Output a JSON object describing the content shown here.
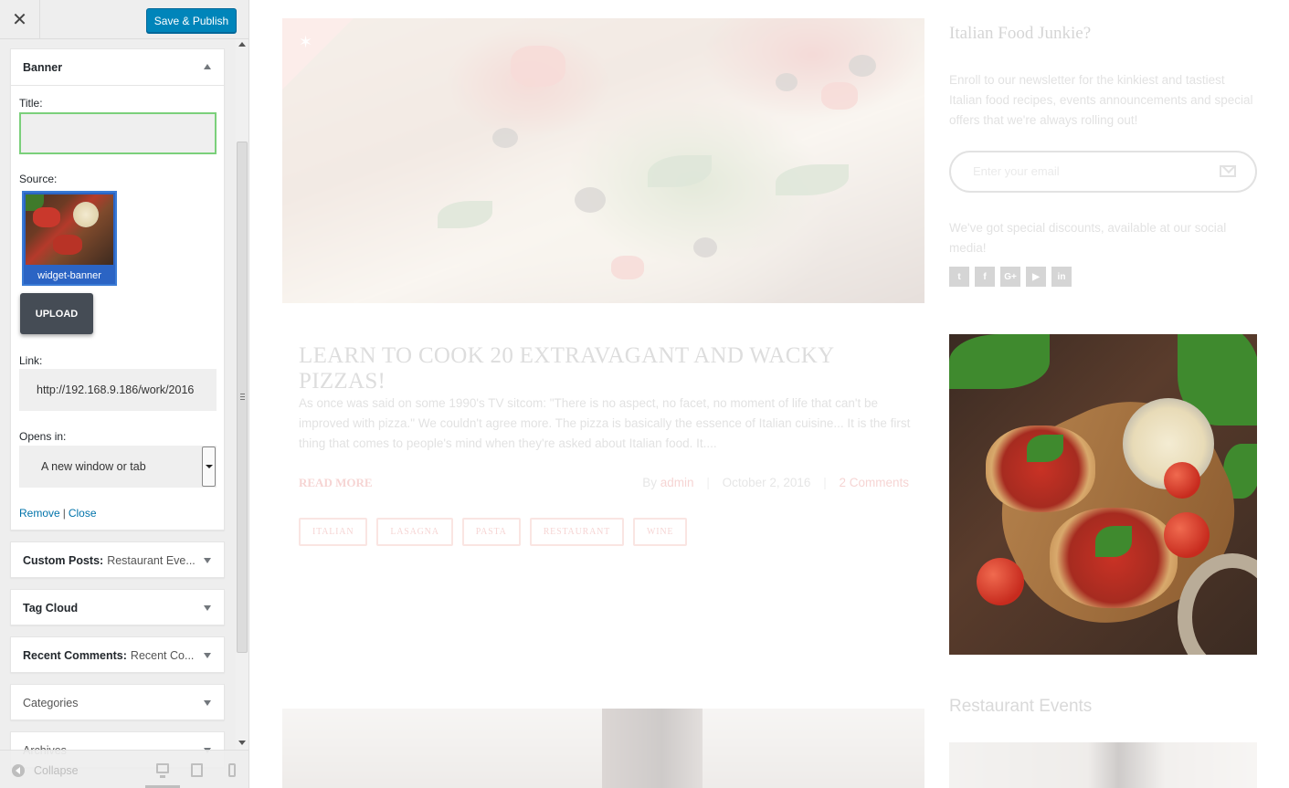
{
  "customizer": {
    "close_label": "✕",
    "save_label": "Save & Publish",
    "banner_widget": {
      "title": "Banner",
      "title_label": "Title:",
      "title_value": "",
      "source_label": "Source:",
      "image_caption": "widget-banner",
      "upload_label": "UPLOAD",
      "link_label": "Link:",
      "link_value": "http://192.168.9.186/work/2016",
      "opens_in_label": "Opens in:",
      "opens_in_value": "A new window or tab",
      "remove_label": "Remove",
      "separator": "|",
      "close_link_label": "Close"
    },
    "widgets": [
      {
        "title": "Custom Posts:",
        "subtitle": "Restaurant Eve..."
      },
      {
        "title": "Tag Cloud",
        "subtitle": ""
      },
      {
        "title": "Recent Comments:",
        "subtitle": "Recent Co..."
      },
      {
        "title": "Categories",
        "subtitle": ""
      },
      {
        "title": "Archives",
        "subtitle": ""
      }
    ],
    "footer": {
      "collapse_label": "Collapse"
    }
  },
  "preview": {
    "post": {
      "title": "LEARN TO COOK 20 EXTRAVAGANT AND WACKY PIZZAS!",
      "excerpt": "As once was said on some 1990's TV sitcom: \"There is no aspect, no facet, no moment of life that can't be improved with pizza.\" We couldn't agree more. The pizza is basically the essence of Italian cuisine... It is the first thing that comes to people's mind when they're asked about Italian food. It....",
      "read_more": "READ MORE",
      "by": "By",
      "author": "admin",
      "date": "October 2, 2016",
      "comments": "2 Comments",
      "tags": [
        "ITALIAN",
        "LASAGNA",
        "PASTA",
        "RESTAURANT",
        "WINE"
      ]
    },
    "newsletter": {
      "title": "Italian Food Junkie?",
      "text": "Enroll to our newsletter for the kinkiest and tastiest Italian food recipes, events announcements and special offers that we're always rolling out!",
      "placeholder": "Enter your email",
      "social_text": "We've got special discounts, available at our social media!",
      "social": [
        "t",
        "f",
        "G+",
        "▶",
        "in"
      ]
    },
    "events_title": "Restaurant Events"
  },
  "colors": {
    "publish_button": "#0085ba",
    "accent": "#d9534f",
    "link": "#0073aa"
  },
  "icons": {
    "close": "close-icon",
    "sticky": "star-icon",
    "email": "envelope-icon",
    "collapse": "arrow-left-circle-icon"
  }
}
